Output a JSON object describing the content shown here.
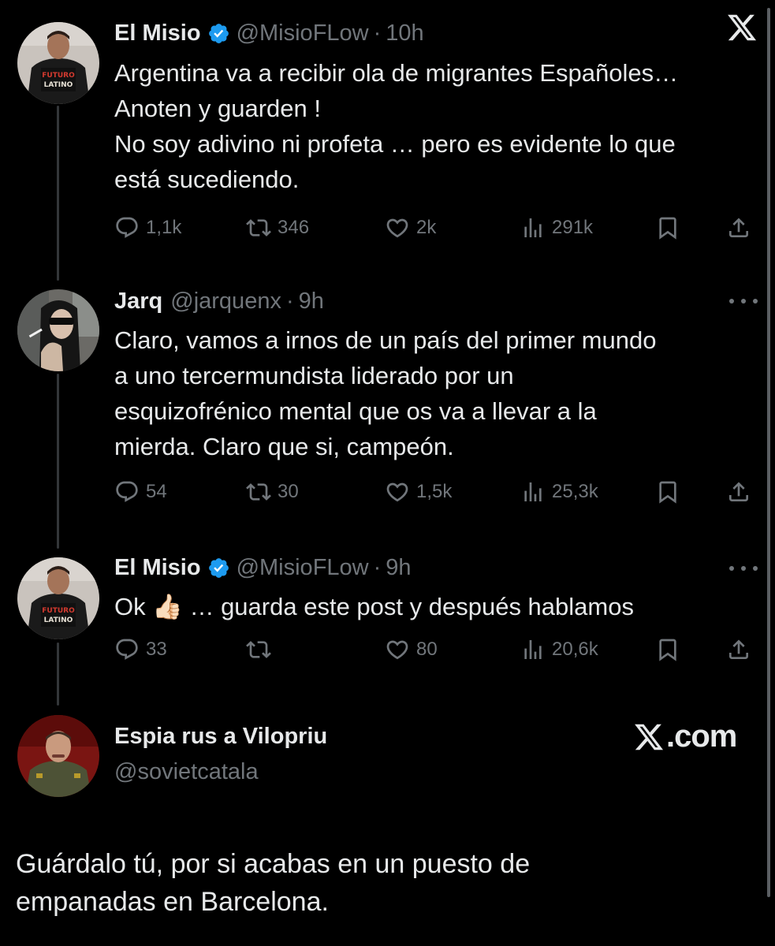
{
  "tweets": [
    {
      "name": "El Misio",
      "handle": "@MisioFLow",
      "time": "10h",
      "verified": true,
      "text": "Argentina va a recibir ola de migrantes Españoles…\nAnoten y guarden !\nNo soy adivino ni profeta … pero es evidente lo que\nestá sucediendo.",
      "replies": "1,1k",
      "reposts": "346",
      "likes": "2k",
      "views": "291k"
    },
    {
      "name": "Jarq",
      "handle": "@jarquenx",
      "time": "9h",
      "verified": false,
      "text": "Claro, vamos a irnos de un país del primer mundo\na uno tercermundista liderado por un\nesquizofrénico mental que os va a llevar a la\nmierda. Claro que si, campeón.",
      "replies": "54",
      "reposts": "30",
      "likes": "1,5k",
      "views": "25,3k"
    },
    {
      "name": "El Misio",
      "handle": "@MisioFLow",
      "time": "9h",
      "verified": true,
      "text_before": "Ok ",
      "emoji": "👍🏻",
      "text_after": " … guarda este post y después hablamos",
      "replies": "33",
      "reposts": "",
      "likes": "80",
      "views": "20,6k"
    }
  ],
  "quote": {
    "name": "Espia rus a Vilopriu",
    "handle": "@sovietcatala",
    "text": "Guárdalo tú, por si acabas en un puesto de\nempanadas en Barcelona.",
    "brand": ".com"
  },
  "colors": {
    "background": "#000000",
    "text": "#e7e9ea",
    "muted": "#71767b",
    "verified": "#1d9bf0"
  },
  "icons": [
    "x-logo-icon",
    "verified-badge-icon",
    "reply-icon",
    "repost-icon",
    "like-icon",
    "views-icon",
    "bookmark-icon",
    "share-icon",
    "more-icon"
  ]
}
